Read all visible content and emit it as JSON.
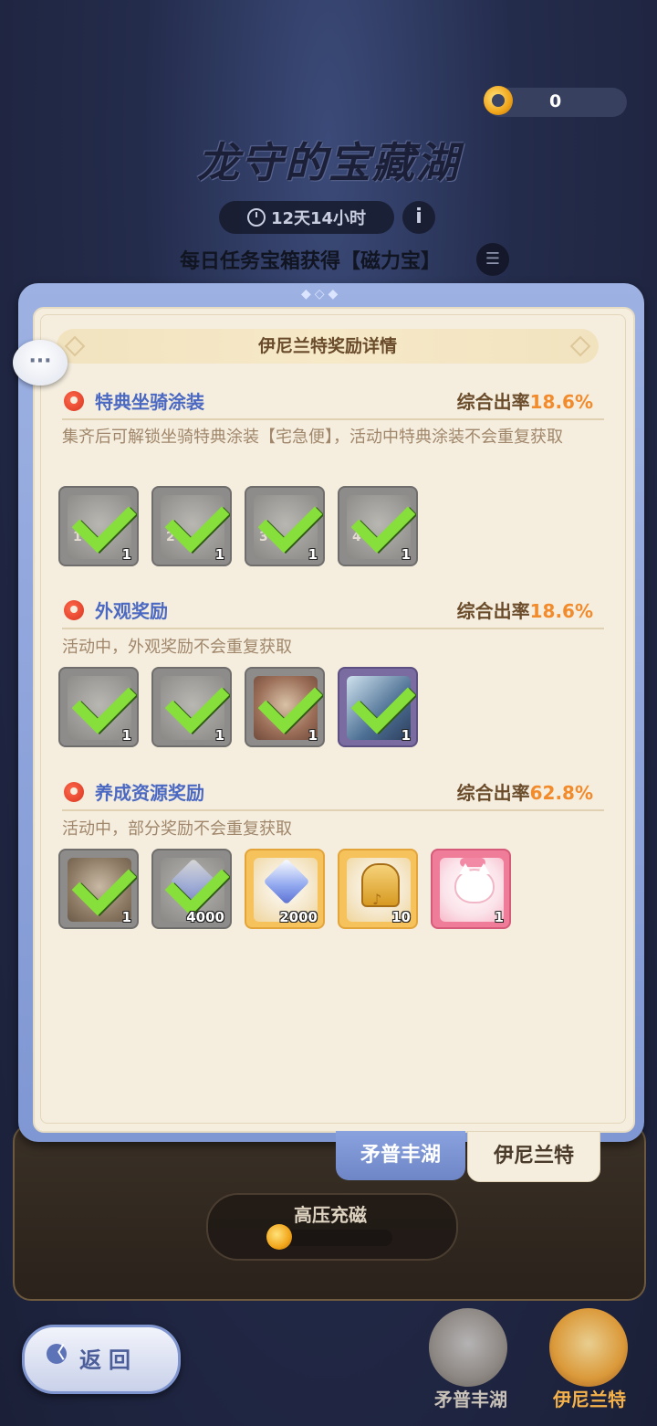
{
  "top": {
    "currency_value": "0",
    "title": "龙守的宝藏湖",
    "timer": "12天14小时",
    "info_symbol": "i",
    "subtitle": "每日任务宝箱获得【磁力宝】",
    "list_symbol": "☰",
    "chat_symbol": "···"
  },
  "panel": {
    "header": "伊尼兰特奖励详情",
    "sections": [
      {
        "title": "特典坐骑涂装",
        "rate_label": "综合出率",
        "rate": "18.6%",
        "desc": "集齐后可解锁坐骑特典涂装【宅急便】，活动中特典涂装不会重复获取",
        "items": [
          {
            "num": "1",
            "count": "1",
            "claimed": true
          },
          {
            "num": "2",
            "count": "1",
            "claimed": true
          },
          {
            "num": "3",
            "count": "1",
            "claimed": true
          },
          {
            "num": "4",
            "count": "1",
            "claimed": true
          }
        ]
      },
      {
        "title": "外观奖励",
        "rate_label": "综合出率",
        "rate": "18.6%",
        "desc": "活动中，外观奖励不会重复获取",
        "items": [
          {
            "count": "1",
            "claimed": true
          },
          {
            "count": "1",
            "claimed": true
          },
          {
            "count": "1",
            "claimed": true
          },
          {
            "count": "1",
            "claimed": true
          }
        ]
      },
      {
        "title": "养成资源奖励",
        "rate_label": "综合出率",
        "rate": "62.8%",
        "desc": "活动中，部分奖励不会重复获取",
        "items": [
          {
            "count": "1",
            "claimed": true
          },
          {
            "count": "4000",
            "claimed": true
          },
          {
            "count": "2000",
            "claimed": false
          },
          {
            "count": "10",
            "claimed": false
          },
          {
            "count": "1",
            "claimed": false
          }
        ]
      }
    ]
  },
  "tabs": {
    "left": "矛普丰湖",
    "right": "伊尼兰特"
  },
  "bottom": {
    "charge_label": "高压充磁",
    "back_label": "返回",
    "back_symbol": "〈",
    "shell_left_label": "矛普丰湖",
    "shell_right_label": "伊尼兰特"
  },
  "colors": {
    "panel_blue": "#8aa2de",
    "accent_orange": "#f28b2c",
    "section_title_blue": "#4b69c2",
    "check_green": "#86df3a"
  }
}
